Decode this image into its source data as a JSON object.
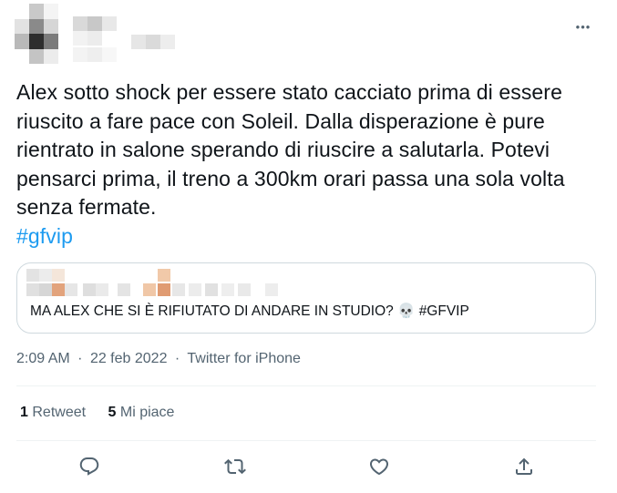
{
  "tweet": {
    "text_main": "Alex sotto shock per essere stato cacciato prima di essere riuscito a fare pace con Soleil. Dalla disperazione è pure rientrato in salone sperando di riuscire a salutarla. Potevi pensarci prima, il treno a 300km orari passa una sola volta senza fermate.",
    "hashtag": "#gfvip",
    "more_label": "•••",
    "quote": {
      "text": "MA ALEX CHE SI È RIFIUTATO DI ANDARE IN STUDIO? 💀 #GFVIP"
    },
    "time": "2:09 AM",
    "separator": "·",
    "date": "22 feb 2022",
    "source": "Twitter for iPhone",
    "stats": {
      "retweets_count": "1",
      "retweets_label": "Retweet",
      "likes_count": "5",
      "likes_label": "Mi piace"
    },
    "icons": {
      "reply": "reply-icon",
      "retweet": "retweet-icon",
      "like": "heart-icon",
      "share": "share-icon"
    }
  }
}
